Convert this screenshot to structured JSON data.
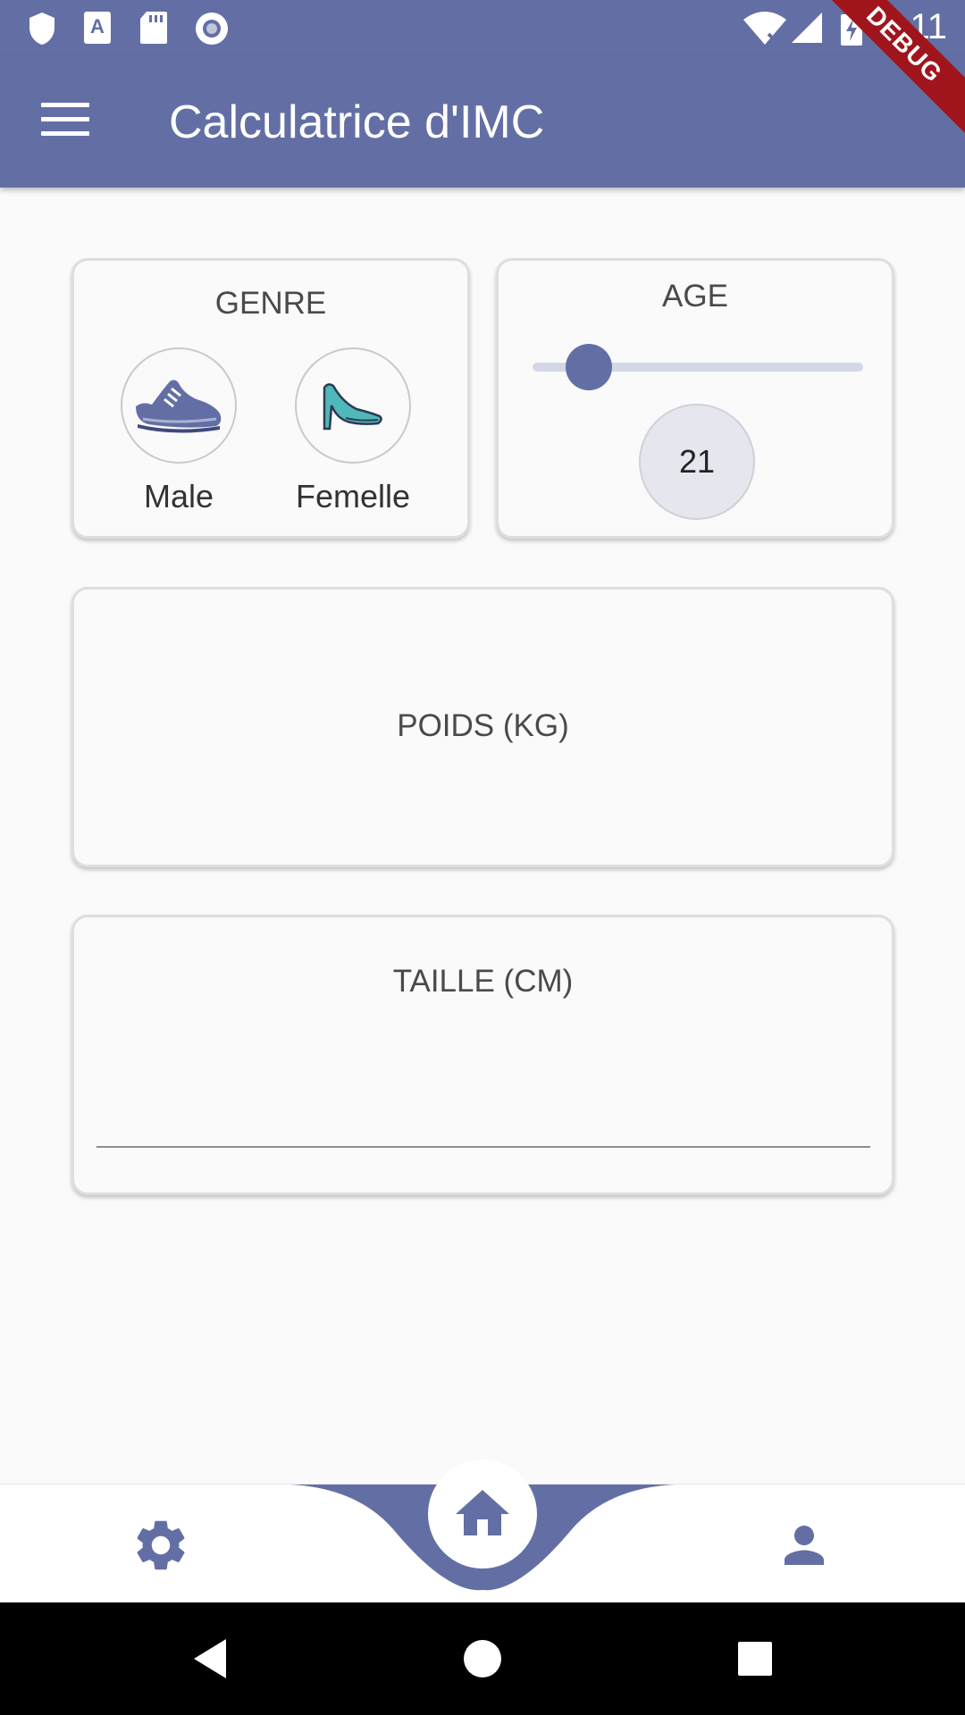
{
  "status_bar": {
    "time": "1:11",
    "icons": [
      "shield-icon",
      "a-icon",
      "sd-card-icon",
      "record-icon",
      "wifi-off-icon",
      "signal-icon",
      "battery-charging-icon"
    ]
  },
  "app_bar": {
    "title": "Calculatrice d'IMC",
    "menu_icon": "menu-icon"
  },
  "debug_banner": "DEBUG",
  "genre_card": {
    "title": "GENRE",
    "options": [
      {
        "label": "Male",
        "icon": "sneaker-icon"
      },
      {
        "label": "Femelle",
        "icon": "high-heel-icon"
      }
    ]
  },
  "age_card": {
    "title": "AGE",
    "value": "21",
    "slider_fraction": 0.17
  },
  "poids_card": {
    "title": "POIDS (KG)"
  },
  "taille_card": {
    "title": "TAILLE (CM)",
    "input_value": ""
  },
  "bottom_nav": {
    "items": [
      "gear-icon",
      "home-icon",
      "person-icon"
    ],
    "active": "home-icon"
  },
  "system_nav": [
    "back-icon",
    "home-circle-icon",
    "recents-icon"
  ],
  "colors": {
    "primary": "#636fa4",
    "background": "#fafafa",
    "accent_female": "#4fb8b8",
    "debug": "#a0151c"
  }
}
